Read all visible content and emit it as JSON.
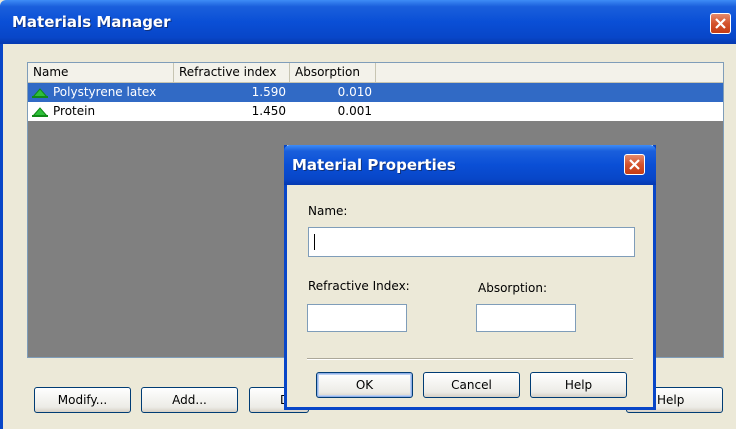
{
  "window": {
    "title": "Materials Manager",
    "close_icon": "close-icon"
  },
  "list": {
    "columns": [
      "Name",
      "Refractive index",
      "Absorption"
    ],
    "rows": [
      {
        "name": "Polystyrene latex",
        "refractive_index": "1.590",
        "absorption": "0.010",
        "selected": true,
        "icon": "material-icon"
      },
      {
        "name": "Protein",
        "refractive_index": "1.450",
        "absorption": "0.001",
        "selected": false,
        "icon": "material-icon"
      }
    ]
  },
  "buttons": {
    "modify": "Modify...",
    "add": "Add...",
    "delete_partial": "D",
    "help": "Help"
  },
  "dialog": {
    "title": "Material Properties",
    "name_label": "Name:",
    "name_value": "",
    "refractive_label": "Refractive Index:",
    "refractive_value": "",
    "absorption_label": "Absorption:",
    "absorption_value": "",
    "ok": "OK",
    "cancel": "Cancel",
    "help": "Help"
  },
  "colors": {
    "selection": "#316ac5",
    "titlebar": "#0a4fd6",
    "window_bg": "#ece9d8",
    "list_bg": "#808080"
  }
}
